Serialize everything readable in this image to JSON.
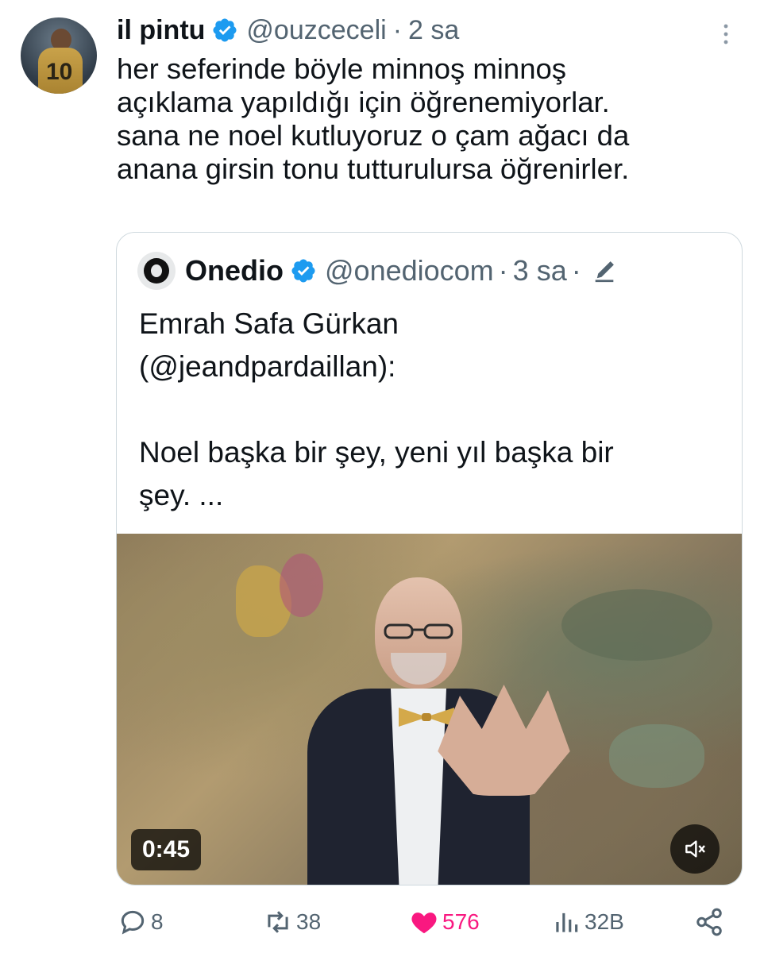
{
  "tweet": {
    "author_name": "il pintu",
    "author_handle": "@ouzceceli",
    "separator": "·",
    "time": "2 sa",
    "text": "her seferinde böyle minnoş minnoş\naçıklama yapıldığı için öğrenemiyorlar.\nsana ne noel kutluyoruz o çam ağacı da\nanana girsin tonu tutturulursa öğrenirler.",
    "avatar_jersey_text": "10"
  },
  "quote": {
    "author_name": "Onedio",
    "author_handle": "@onediocom",
    "separator": "·",
    "time": "3 sa",
    "separator2": "·",
    "text": "Emrah Safa Gürkan\n(@jeandpardaillan):\n\nNoel başka bir şey, yeni yıl başka bir\nşey. ...",
    "video_duration": "0:45"
  },
  "actions": {
    "replies": "8",
    "retweets": "38",
    "likes": "576",
    "views": "32B"
  },
  "colors": {
    "verified": "#1d9bf0",
    "secondary_text": "#536471",
    "like": "#f91880",
    "border": "#cfd9de"
  },
  "icons": [
    "verified-badge-icon",
    "more-vertical-icon",
    "edit-icon",
    "mute-icon",
    "reply-icon",
    "retweet-icon",
    "like-icon",
    "views-icon",
    "share-icon"
  ]
}
